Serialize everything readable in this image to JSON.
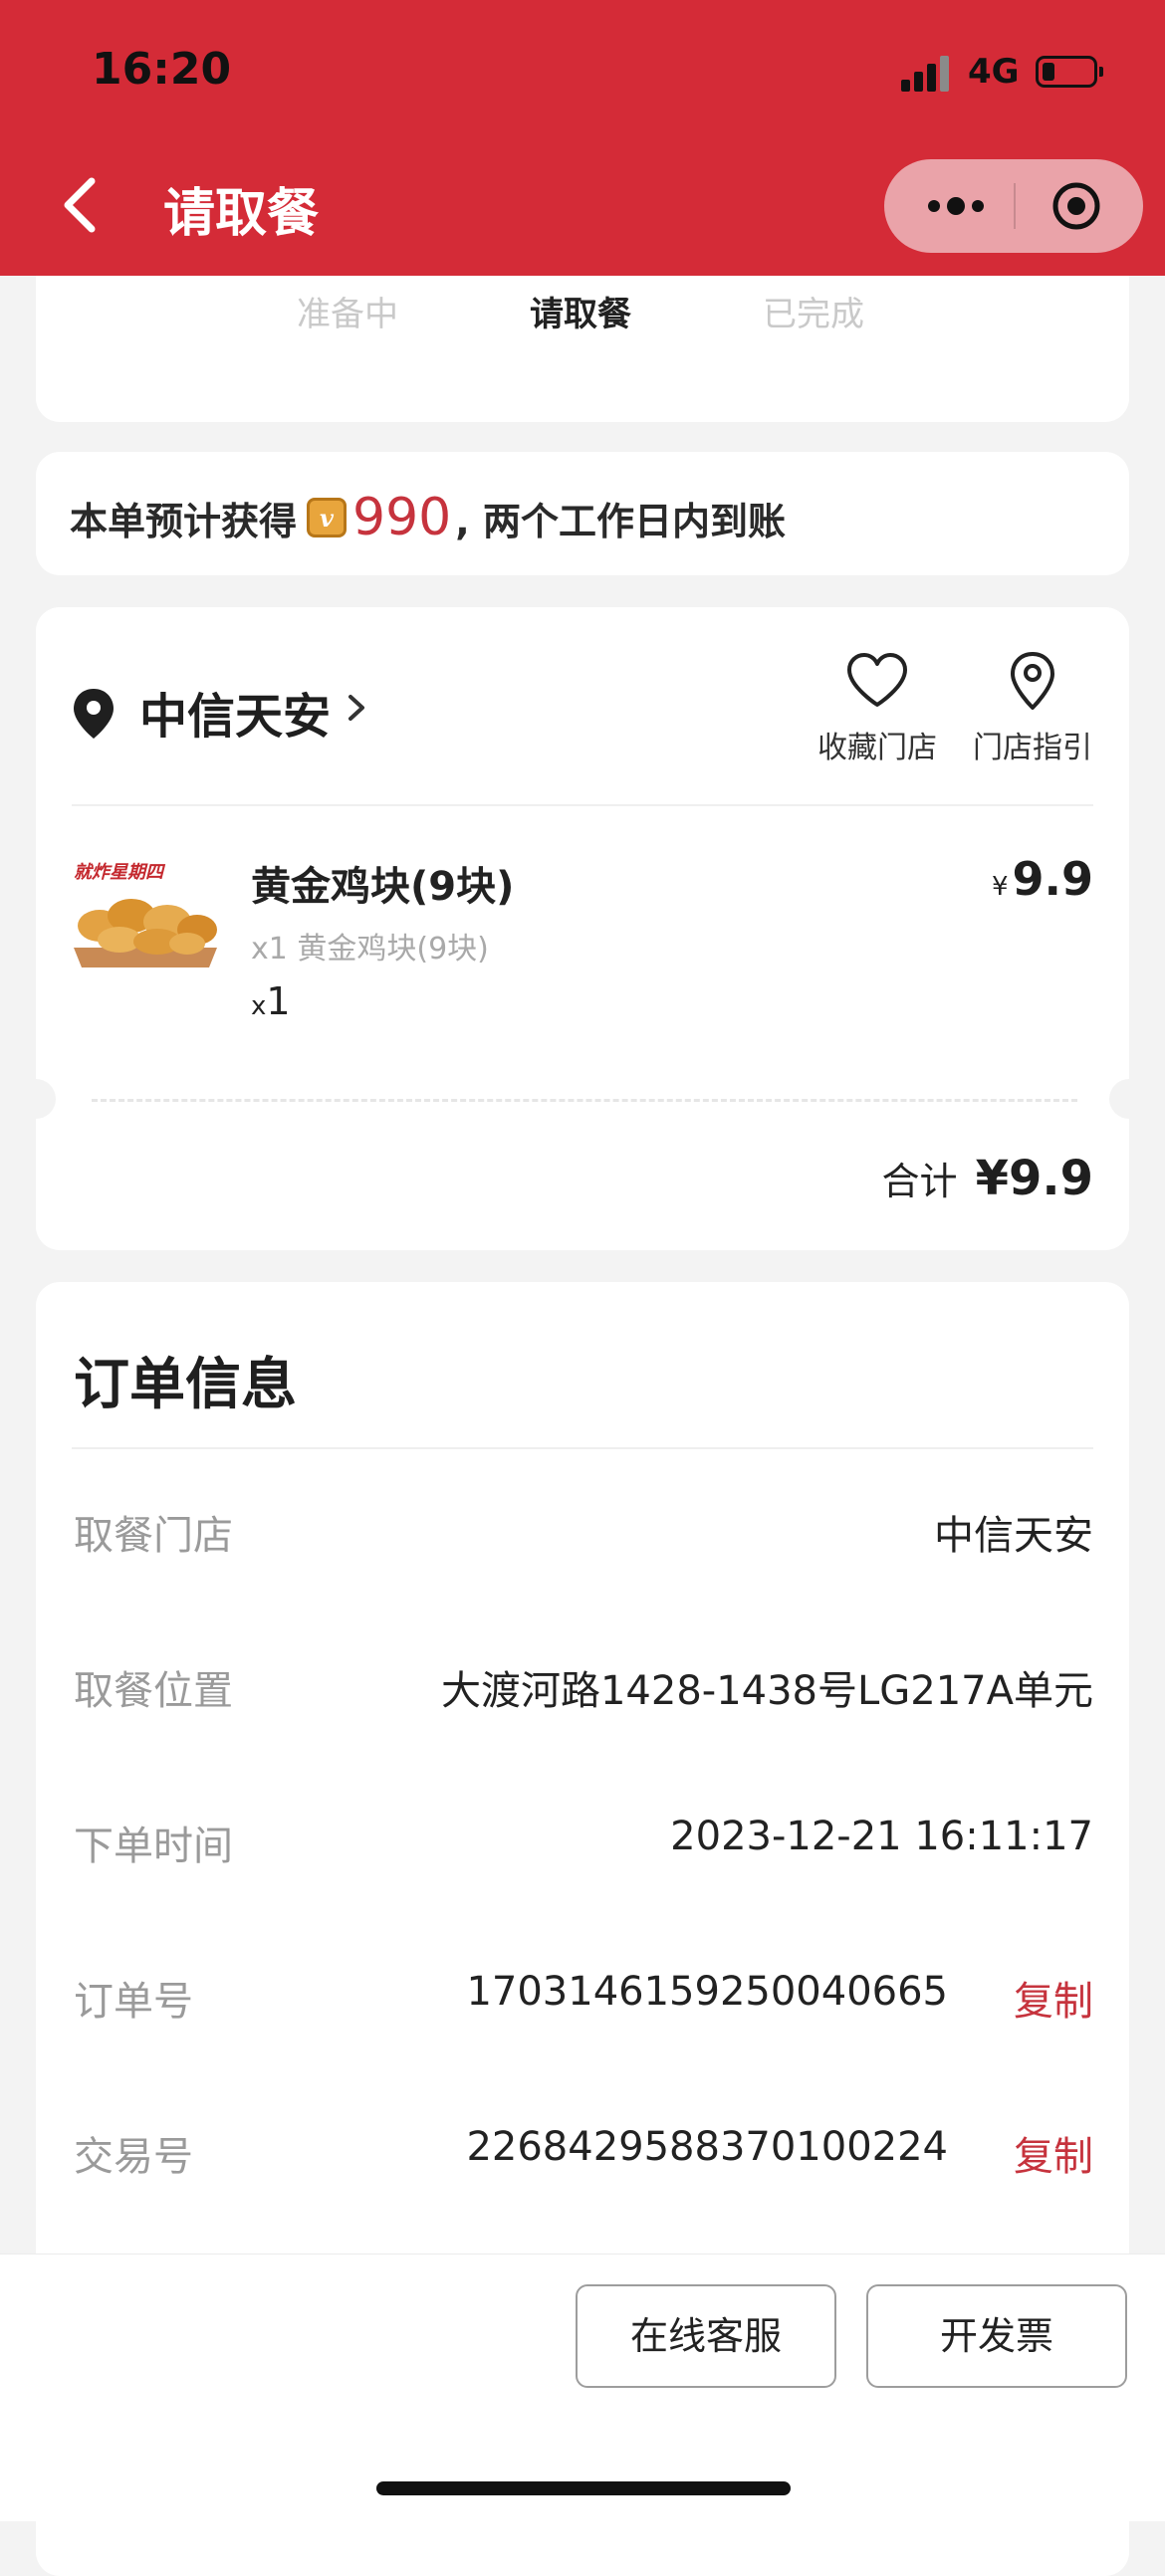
{
  "status_bar": {
    "time": "16:20",
    "network": "4G"
  },
  "header": {
    "title": "请取餐"
  },
  "progress": {
    "steps": [
      "准备中",
      "请取餐",
      "已完成"
    ],
    "active_index": 1
  },
  "points": {
    "prefix": "本单预计获得",
    "amount": "990",
    "suffix": ", 两个工作日内到账"
  },
  "store": {
    "name": "中信天安",
    "favorite_label": "收藏门店",
    "guide_label": "门店指引"
  },
  "item": {
    "image_caption": "就炸星期四",
    "name": "黄金鸡块(9块)",
    "detail": "x1 黄金鸡块(9块)",
    "qty_prefix": "x",
    "qty": "1",
    "currency": "¥",
    "price": "9.9"
  },
  "total": {
    "label": "合计",
    "value": "¥9.9"
  },
  "order_info": {
    "title": "订单信息",
    "rows": [
      {
        "label": "取餐门店",
        "value": "中信天安"
      },
      {
        "label": "取餐位置",
        "value": "大渡河路1428-1438号LG217A单元"
      },
      {
        "label": "下单时间",
        "value": "2023-12-21 16:11:17"
      },
      {
        "label": "订单号",
        "value": "1703146159250040665",
        "action": "复制"
      },
      {
        "label": "交易号",
        "value": "2268429588370100224",
        "action": "复制"
      }
    ]
  },
  "bottom": {
    "service_label": "在线客服",
    "invoice_label": "开发票"
  },
  "colors": {
    "brand_red": "#d42b37",
    "accent_red": "#c6333d"
  }
}
